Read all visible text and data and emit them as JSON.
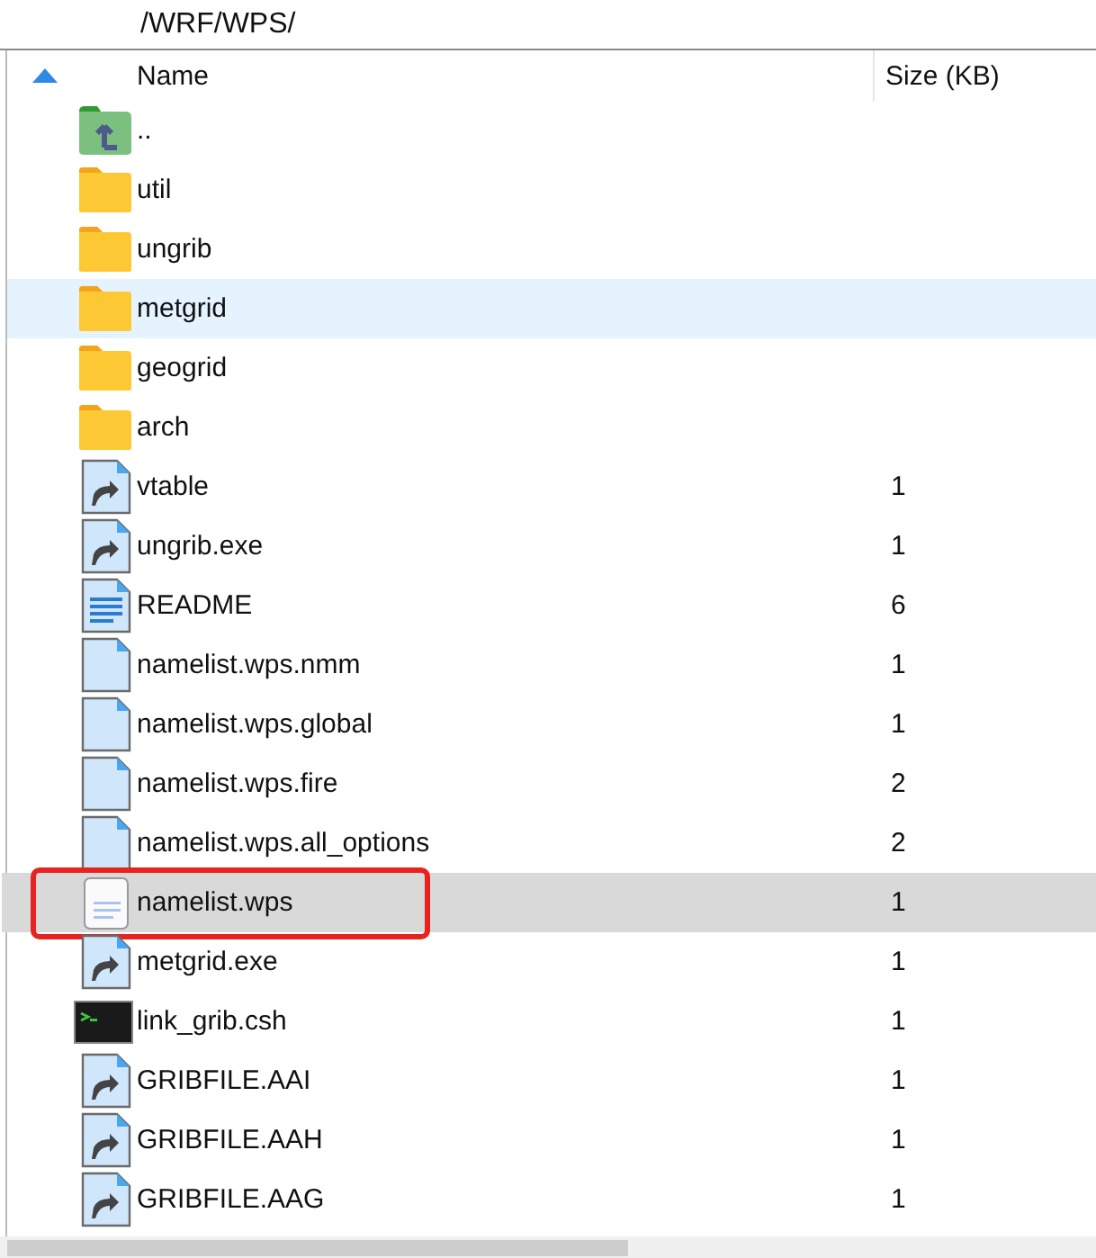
{
  "path": "/WRF/WPS/",
  "columns": [
    {
      "label": "Name",
      "sorted": true
    },
    {
      "label": "Size (KB)",
      "sorted": false
    }
  ],
  "rows": [
    {
      "name": "..",
      "kind": "parent",
      "size": "",
      "hovered": false,
      "selected": false,
      "outlined": false
    },
    {
      "name": "util",
      "kind": "folder",
      "size": "",
      "hovered": false,
      "selected": false,
      "outlined": false
    },
    {
      "name": "ungrib",
      "kind": "folder",
      "size": "",
      "hovered": false,
      "selected": false,
      "outlined": false
    },
    {
      "name": "metgrid",
      "kind": "folder",
      "size": "",
      "hovered": true,
      "selected": false,
      "outlined": false
    },
    {
      "name": "geogrid",
      "kind": "folder",
      "size": "",
      "hovered": false,
      "selected": false,
      "outlined": false
    },
    {
      "name": "arch",
      "kind": "folder",
      "size": "",
      "hovered": false,
      "selected": false,
      "outlined": false
    },
    {
      "name": "vtable",
      "kind": "link",
      "size": "1",
      "hovered": false,
      "selected": false,
      "outlined": false
    },
    {
      "name": "ungrib.exe",
      "kind": "link",
      "size": "1",
      "hovered": false,
      "selected": false,
      "outlined": false
    },
    {
      "name": "README",
      "kind": "text",
      "size": "6",
      "hovered": false,
      "selected": false,
      "outlined": false
    },
    {
      "name": "namelist.wps.nmm",
      "kind": "file",
      "size": "1",
      "hovered": false,
      "selected": false,
      "outlined": false
    },
    {
      "name": "namelist.wps.global",
      "kind": "file",
      "size": "1",
      "hovered": false,
      "selected": false,
      "outlined": false
    },
    {
      "name": "namelist.wps.fire",
      "kind": "file",
      "size": "2",
      "hovered": false,
      "selected": false,
      "outlined": false
    },
    {
      "name": "namelist.wps.all_options",
      "kind": "file",
      "size": "2",
      "hovered": false,
      "selected": false,
      "outlined": false
    },
    {
      "name": "namelist.wps",
      "kind": "note",
      "size": "1",
      "hovered": false,
      "selected": true,
      "outlined": true
    },
    {
      "name": "metgrid.exe",
      "kind": "link",
      "size": "1",
      "hovered": false,
      "selected": false,
      "outlined": false
    },
    {
      "name": "link_grib.csh",
      "kind": "terminal",
      "size": "1",
      "hovered": false,
      "selected": false,
      "outlined": false
    },
    {
      "name": "GRIBFILE.AAI",
      "kind": "link",
      "size": "1",
      "hovered": false,
      "selected": false,
      "outlined": false
    },
    {
      "name": "GRIBFILE.AAH",
      "kind": "link",
      "size": "1",
      "hovered": false,
      "selected": false,
      "outlined": false
    },
    {
      "name": "GRIBFILE.AAG",
      "kind": "link",
      "size": "1",
      "hovered": false,
      "selected": false,
      "outlined": false
    }
  ]
}
